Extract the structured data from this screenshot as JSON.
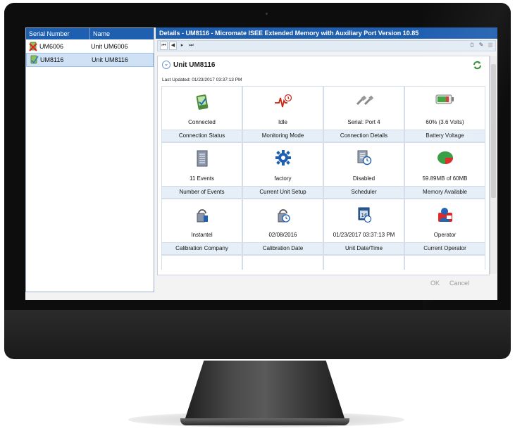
{
  "left_panel": {
    "col_serial": "Serial Number",
    "col_name": "Name",
    "rows": [
      {
        "serial": "UM6006",
        "name": "Unit UM6006",
        "icon": "disconnected-unit-icon"
      },
      {
        "serial": "UM8116",
        "name": "Unit UM8116",
        "icon": "connected-unit-icon"
      }
    ]
  },
  "details": {
    "title": "Details - UM8116 - Micromate  ISEE Extended Memory with Auxiliary Port Version 10.85",
    "unit_header": "Unit UM8116",
    "last_updated": "Last Updated:  01/23/2017 03:37:13 PM",
    "tiles": [
      {
        "value": "Connected",
        "label": "Connection Status",
        "icon": "connection-status-icon"
      },
      {
        "value": "Idle",
        "label": "Monitoring Mode",
        "icon": "heartbeat-icon"
      },
      {
        "value": "Serial: Port 4",
        "label": "Connection Details",
        "icon": "serial-cable-icon"
      },
      {
        "value": "60% (3.6 Volts)",
        "label": "Battery Voltage",
        "icon": "battery-icon"
      },
      {
        "value": "11 Events",
        "label": "Number of Events",
        "icon": "events-document-icon"
      },
      {
        "value": "factory",
        "label": "Current Unit Setup",
        "icon": "gear-icon"
      },
      {
        "value": "Disabled",
        "label": "Scheduler",
        "icon": "scheduler-icon"
      },
      {
        "value": "59.89MB of 60MB",
        "label": "Memory Available",
        "icon": "pie-chart-icon"
      },
      {
        "value": "Instantel",
        "label": "Calibration Company",
        "icon": "calibration-company-icon"
      },
      {
        "value": "02/08/2016",
        "label": "Calibration Date",
        "icon": "calibration-date-icon"
      },
      {
        "value": "01/23/2017 03:37:13 PM",
        "label": "Unit Date/Time",
        "icon": "calendar-clock-icon"
      },
      {
        "value": "Operator",
        "label": "Current Operator",
        "icon": "operator-icon"
      }
    ],
    "ok_label": "OK",
    "cancel_label": "Cancel"
  },
  "colors": {
    "header_blue": "#1f5fb0",
    "selected_row": "#cfe1f5",
    "tile_label_bg": "#e6eef7"
  }
}
